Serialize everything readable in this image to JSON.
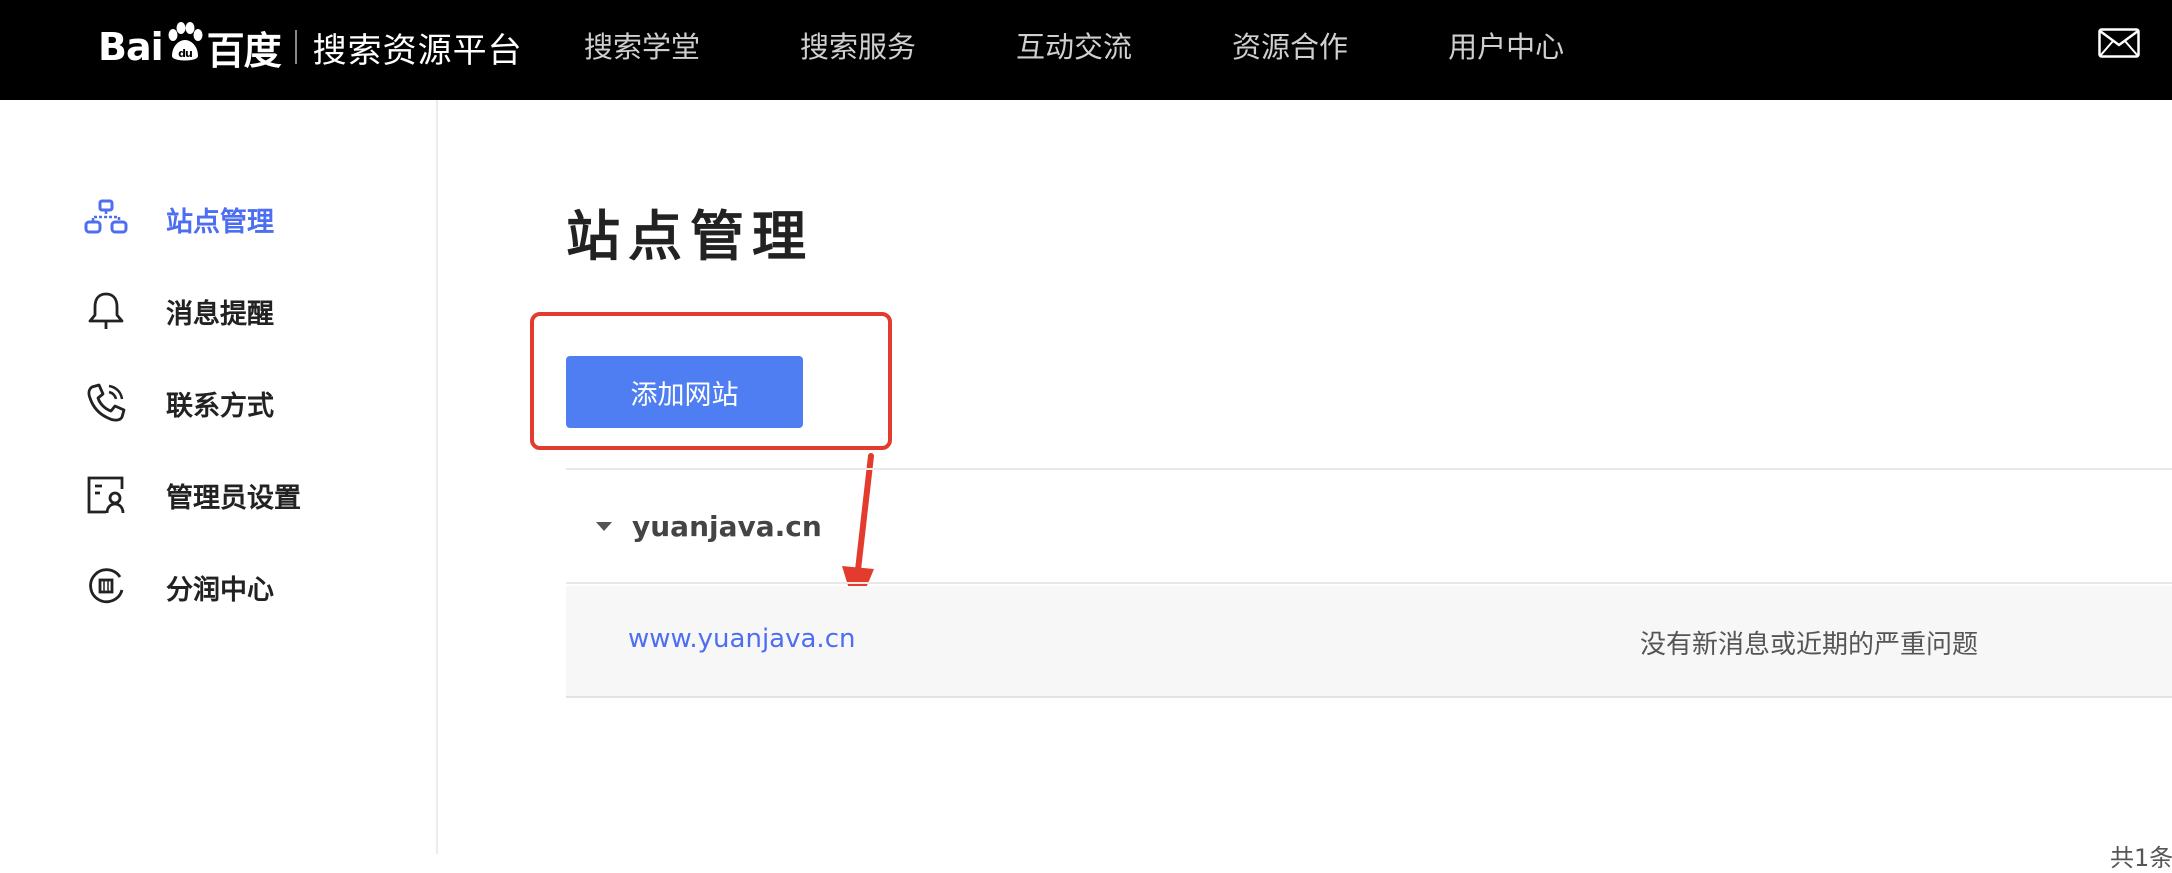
{
  "brand": {
    "logo_left": "Bai",
    "logo_paw": "du",
    "logo_right": "百度",
    "platform_name": "搜索资源平台"
  },
  "top_nav": [
    {
      "label": "搜索学堂",
      "icon": null
    },
    {
      "label": "搜索服务",
      "icon": null
    },
    {
      "label": "互动交流",
      "icon": null
    },
    {
      "label": "资源合作",
      "icon": null
    },
    {
      "label": "用户中心",
      "icon": null
    }
  ],
  "header_icons": {
    "mail": "mail-icon"
  },
  "sidebar": {
    "items": [
      {
        "label": "站点管理",
        "icon": "sitemap-icon",
        "active": true
      },
      {
        "label": "消息提醒",
        "icon": "bell-icon",
        "active": false
      },
      {
        "label": "联系方式",
        "icon": "phone-icon",
        "active": false
      },
      {
        "label": "管理员设置",
        "icon": "admin-id-icon",
        "active": false
      },
      {
        "label": "分润中心",
        "icon": "revenue-icon",
        "active": false
      }
    ]
  },
  "main": {
    "title": "站点管理",
    "add_button": "添加网站",
    "site_group": {
      "name": "yuanjava.cn",
      "expanded": true,
      "sites": [
        {
          "url": "www.yuanjava.cn",
          "status": "没有新消息或近期的严重问题"
        }
      ]
    },
    "pager_partial": "共1条"
  },
  "colors": {
    "accent": "#4e6ef2",
    "button": "#4e7ef2",
    "annotation": "#e33b2e",
    "topbar": "#000000"
  }
}
